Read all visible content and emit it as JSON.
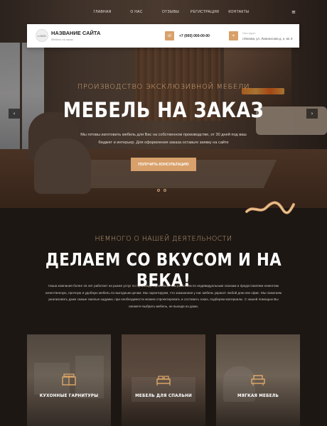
{
  "nav": {
    "links": [
      "ГЛАВНАЯ",
      "О НАС",
      "ОТЗЫВЫ",
      "РЕГИСТРАЦИЯ",
      "КОНТАКТЫ"
    ],
    "menu_icon": "hamburger-icon"
  },
  "header": {
    "logo_text": "LOGO",
    "site_name": "НАЗВАНИЕ САЙТА",
    "site_tagline": "Мебель на заказ",
    "phone": "+7 (000) 000-00-00",
    "address_label": "Наш адрес",
    "address": "г.Москва, ул. Ломоносова д. н, кв. 6"
  },
  "hero": {
    "eyebrow": "ПРОИЗВОДСТВО ЭКСКЛЮЗИВНОЙ МЕБЕЛИ",
    "title": "МЕБЕЛЬ НА ЗАКАЗ",
    "description": "Мы готовы изготовить мебель для Вас на собственном производстве, от 30 дней под ваш бюджет и интерьер. Для оформления заказа оставьте заявку на сайте",
    "cta": "ПОЛУЧИТЬ КОНСУЛЬТАЦИЮ",
    "prev_icon": "chevron-left-icon",
    "next_icon": "chevron-right-icon"
  },
  "about": {
    "eyebrow": "НЕМНОГО О НАШЕЙ ДЕЯТЕЛЬНОСТИ",
    "title": "ДЕЛАЕМ СО ВКУСОМ И НА ВЕКА!",
    "text": "Наша компания более 15 лет работает на рынке услуг по производству мебели. Мы работаем по индивидуальным эскизам и предоставляем клиентам качественную, прочную и удобную мебель по выгодным ценам. Мы гарантируем, что заказанная у нас мебель украсит любой дом или офис. Мы помогаем реализовать даже самые смелые задумки, при необходимости можем спроектировать и составить эскиз, подберем материалы. С нашей помощью Вы сможете выбрать мебель, не выходя из дома."
  },
  "cards": [
    {
      "label": "КУХОННЫЕ ГАРНИТУРЫ",
      "icon": "kitchen-icon"
    },
    {
      "label": "МЕБЕЛЬ ДЛЯ СПАЛЬНИ",
      "icon": "bed-icon"
    },
    {
      "label": "МЯГКАЯ МЕБЕЛЬ",
      "icon": "armchair-icon"
    }
  ],
  "colors": {
    "accent": "#d8a06a",
    "background": "#1c1713",
    "eyebrow": "#c9a07a"
  }
}
